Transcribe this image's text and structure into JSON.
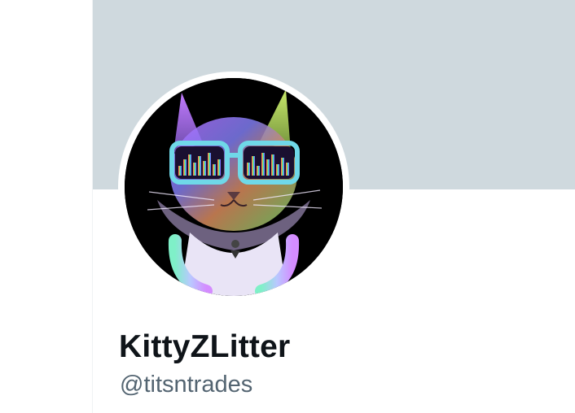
{
  "profile": {
    "display_name": "KittyZLitter",
    "handle": "@titsntrades",
    "avatar_icon": "dj-cat-with-sunglasses-avatar",
    "banner_color": "#cfd9de"
  },
  "colors": {
    "background": "#ffffff",
    "name_text": "#0f1419",
    "handle_text": "#536471",
    "divider": "#eff3f4"
  }
}
